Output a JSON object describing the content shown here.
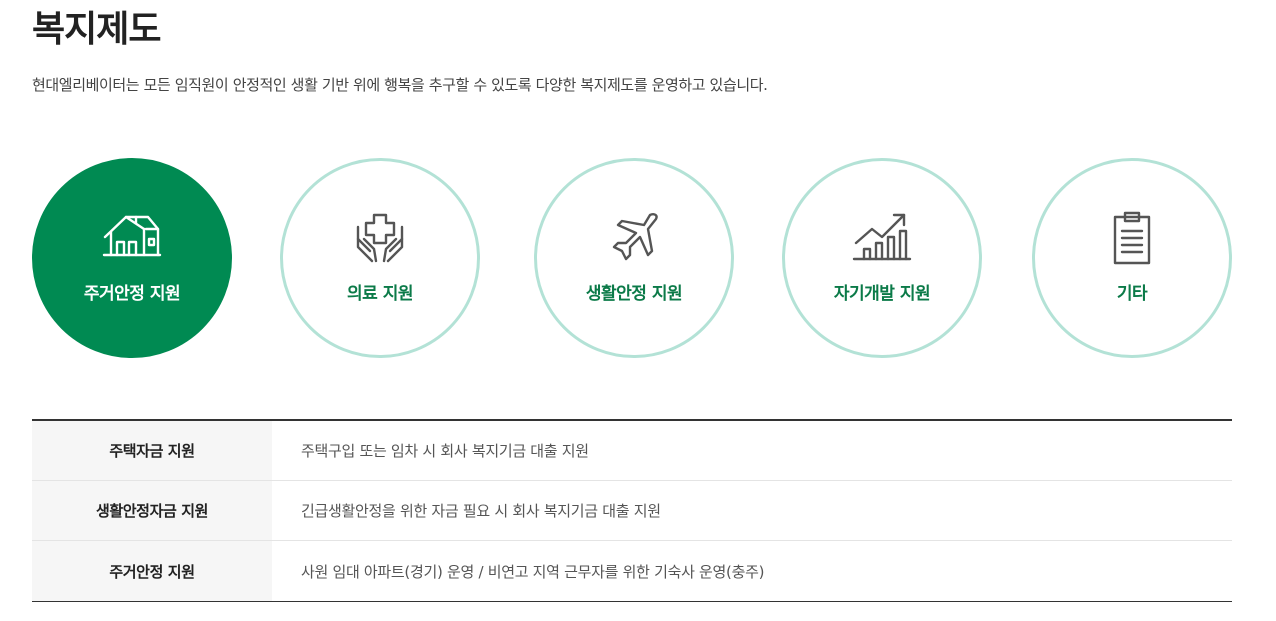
{
  "header": {
    "title": "복지제도",
    "description": "현대엘리베이터는 모든 임직원이 안정적인 생활 기반 위에 행복을 추구할 수 있도록 다양한 복지제도를 운영하고 있습니다."
  },
  "tabs": [
    {
      "label": "주거안정 지원",
      "icon": "house-icon",
      "active": true
    },
    {
      "label": "의료 지원",
      "icon": "medical-hands-icon",
      "active": false
    },
    {
      "label": "생활안정 지원",
      "icon": "airplane-icon",
      "active": false
    },
    {
      "label": "자기개발 지원",
      "icon": "growth-chart-icon",
      "active": false
    },
    {
      "label": "기타",
      "icon": "clipboard-icon",
      "active": false
    }
  ],
  "table": {
    "rows": [
      {
        "head": "주택자금 지원",
        "content": "주택구입 또는 임차 시 회사 복지기금 대출 지원"
      },
      {
        "head": "생활안정자금 지원",
        "content": "긴급생활안정을 위한 자금 필요 시 회사 복지기금 대출 지원"
      },
      {
        "head": "주거안정 지원",
        "content": "사원 임대 아파트(경기) 운영 / 비연고 지역 근무자를 위한 기숙사 운영(충주)"
      }
    ]
  },
  "colors": {
    "accent": "#008a52",
    "accent_text": "#0b7a48",
    "circle_border": "#b3e2d6",
    "icon_gray": "#555555"
  }
}
